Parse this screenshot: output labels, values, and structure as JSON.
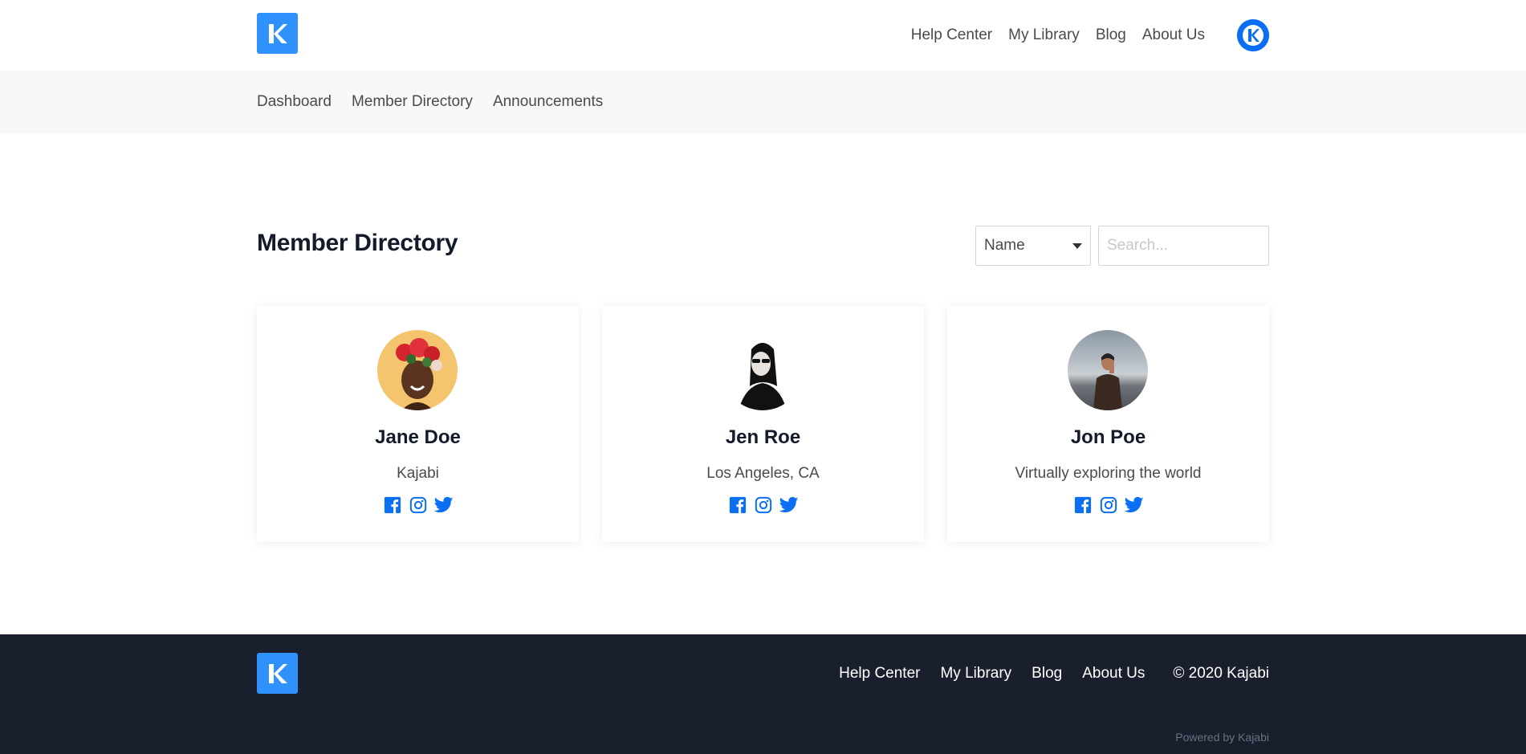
{
  "header": {
    "logo_icon": "kajabi-logo-icon",
    "nav": [
      "Help Center",
      "My Library",
      "Blog",
      "About Us"
    ],
    "avatar_icon": "user-avatar-icon"
  },
  "subnav": [
    "Dashboard",
    "Member Directory",
    "Announcements"
  ],
  "main": {
    "title": "Member Directory",
    "filter": {
      "selected": "Name",
      "options": [
        "Name"
      ]
    },
    "search": {
      "placeholder": "Search...",
      "value": ""
    }
  },
  "members": [
    {
      "name": "Jane Doe",
      "location": "Kajabi",
      "photo_icon": "member-photo",
      "socials": [
        "facebook-icon",
        "instagram-icon",
        "twitter-icon"
      ]
    },
    {
      "name": "Jen Roe",
      "location": "Los Angeles, CA",
      "photo_icon": "member-photo",
      "socials": [
        "facebook-icon",
        "instagram-icon",
        "twitter-icon"
      ]
    },
    {
      "name": "Jon Poe",
      "location": "Virtually exploring the world",
      "photo_icon": "member-photo",
      "socials": [
        "facebook-icon",
        "instagram-icon",
        "twitter-icon"
      ]
    }
  ],
  "footer": {
    "nav": [
      "Help Center",
      "My Library",
      "Blog",
      "About Us"
    ],
    "copyright": "© 2020 Kajabi",
    "powered_by": "Powered by Kajabi"
  },
  "colors": {
    "brand_blue": "#2e91fc",
    "social_blue": "#0a6ff2",
    "title": "#131a2a",
    "footer_bg": "#1a1f2d",
    "subnav_bg": "#f8f8f8"
  }
}
